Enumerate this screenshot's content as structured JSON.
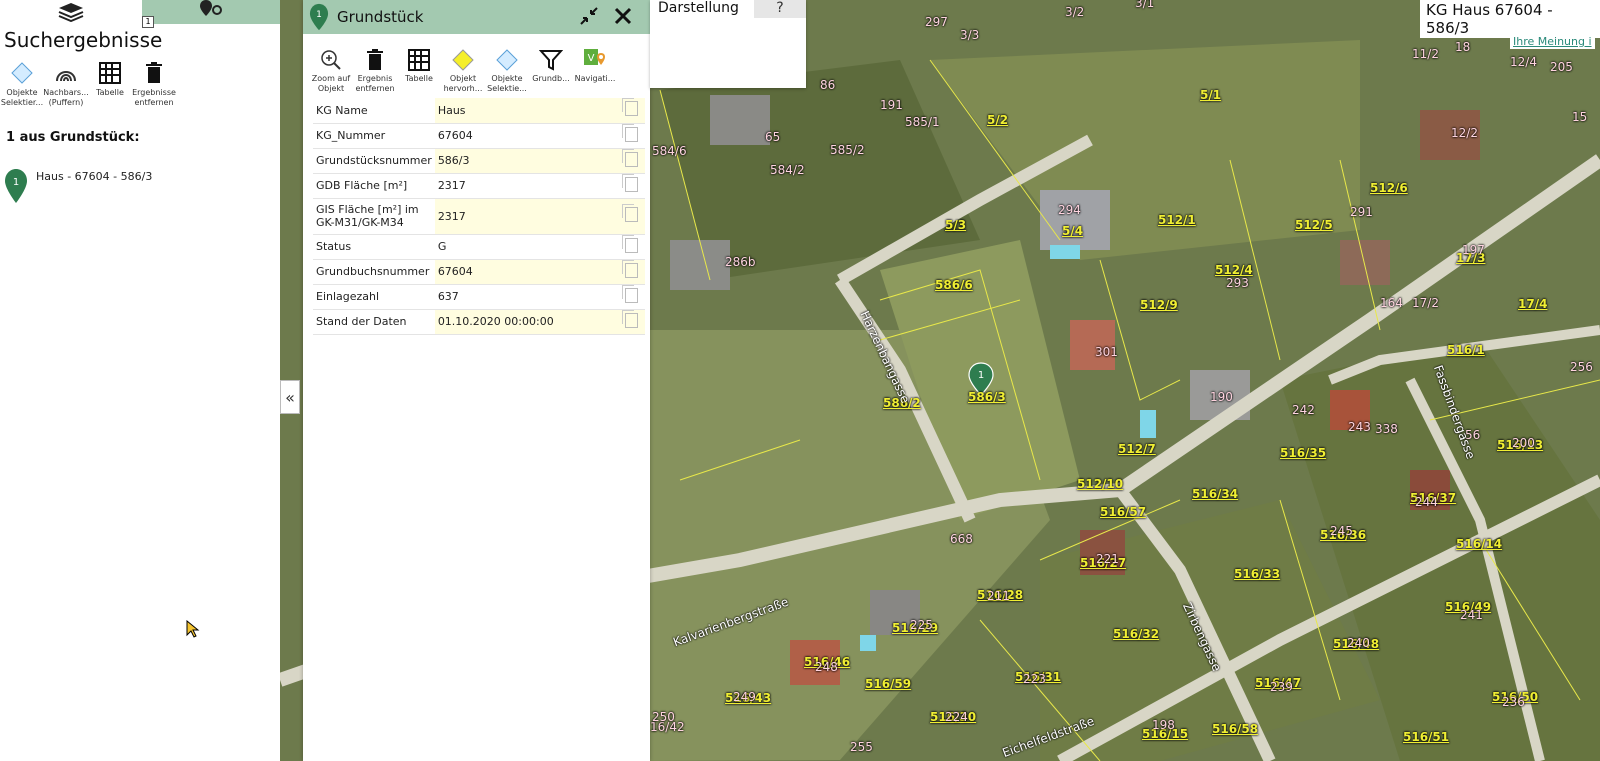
{
  "sidebar": {
    "title": "Suchergebnisse",
    "badge": "1",
    "tools": [
      {
        "label": "Objekte Selektier...",
        "icon": "diamond-icon"
      },
      {
        "label": "Nachbars... (Puffern)",
        "icon": "buffer-icon"
      },
      {
        "label": "Tabelle",
        "icon": "table-icon"
      },
      {
        "label": "Ergebnisse entfernen",
        "icon": "trash-icon"
      }
    ],
    "result_count": "1 aus Grundstück:",
    "result_marker": "1",
    "result_text": "Haus - 67604 - 586/3"
  },
  "panel": {
    "title": "Grundstück",
    "marker": "1",
    "tools": [
      {
        "label": "Zoom auf Objekt",
        "icon": "zoom-icon"
      },
      {
        "label": "Ergebnis entfernen",
        "icon": "trash-icon"
      },
      {
        "label": "Tabelle",
        "icon": "table-icon"
      },
      {
        "label": "Objekt hervorh...",
        "icon": "highlight-icon"
      },
      {
        "label": "Objekte Selektie...",
        "icon": "diamond-icon"
      },
      {
        "label": "Grundb...",
        "icon": "filter-icon"
      },
      {
        "label": "Navigati...",
        "icon": "navigation-icon"
      }
    ],
    "rows": [
      {
        "key": "KG Name",
        "value": "Haus"
      },
      {
        "key": "KG_Nummer",
        "value": "67604"
      },
      {
        "key": "Grundstücksnummer",
        "value": "586/3"
      },
      {
        "key": "GDB Fläche [m²]",
        "value": "2317"
      },
      {
        "key": "GIS Fläche [m²] im GK-M31/GK-M34",
        "value": "2317"
      },
      {
        "key": "Status",
        "value": "G"
      },
      {
        "key": "Grundbuchsnummer",
        "value": "67604"
      },
      {
        "key": "Einlagezahl",
        "value": "637"
      },
      {
        "key": "Stand der Daten",
        "value": "01.10.2020 00:00:00"
      }
    ]
  },
  "collapse": "«",
  "darstellung": {
    "tab": "Darstellung",
    "help": "?"
  },
  "map": {
    "kg_label": "KG Haus 67604 - 586/3",
    "feedback_link": "Ihre Meinung i",
    "marker": "1",
    "selected_plot": "586/3",
    "streets": [
      "Kalvarienbergstraße",
      "Harzenbangasse",
      "Zirbengasse",
      "Fassbindergasse",
      "Eichelfeldstraße"
    ],
    "plots": [
      "5/1",
      "5/2",
      "5/3",
      "5/4",
      "586/6",
      "586/2",
      "512/1",
      "512/5",
      "512/4",
      "512/9",
      "512/6",
      "512/7",
      "512/10",
      "516/57",
      "516/34",
      "516/35",
      "516/36",
      "516/33",
      "516/27",
      "516/28",
      "516/29",
      "516/32",
      "516/31",
      "516/30",
      "516/46",
      "516/43",
      "516/59",
      "516/48",
      "516/47",
      "516/49",
      "516/50",
      "516/51",
      "516/58",
      "516/15",
      "516/37",
      "516/13",
      "516/14",
      "516/1",
      "17/3",
      "17/4",
      "12/2",
      "11/2",
      "12/4",
      "3/2",
      "3/3",
      "3/1",
      "585/1",
      "585/2",
      "584/2",
      "584/6",
      "668",
      "16/42"
    ],
    "house_numbers": [
      "294",
      "293",
      "301",
      "190",
      "242",
      "243",
      "244",
      "245",
      "221",
      "211",
      "225",
      "248",
      "249",
      "223",
      "224",
      "236",
      "239",
      "240",
      "241",
      "200",
      "197",
      "291",
      "164",
      "17/2",
      "65",
      "86",
      "191",
      "297",
      "286b",
      "250",
      "198",
      "255",
      "18",
      "15",
      "205",
      "256",
      "56",
      "338"
    ]
  }
}
